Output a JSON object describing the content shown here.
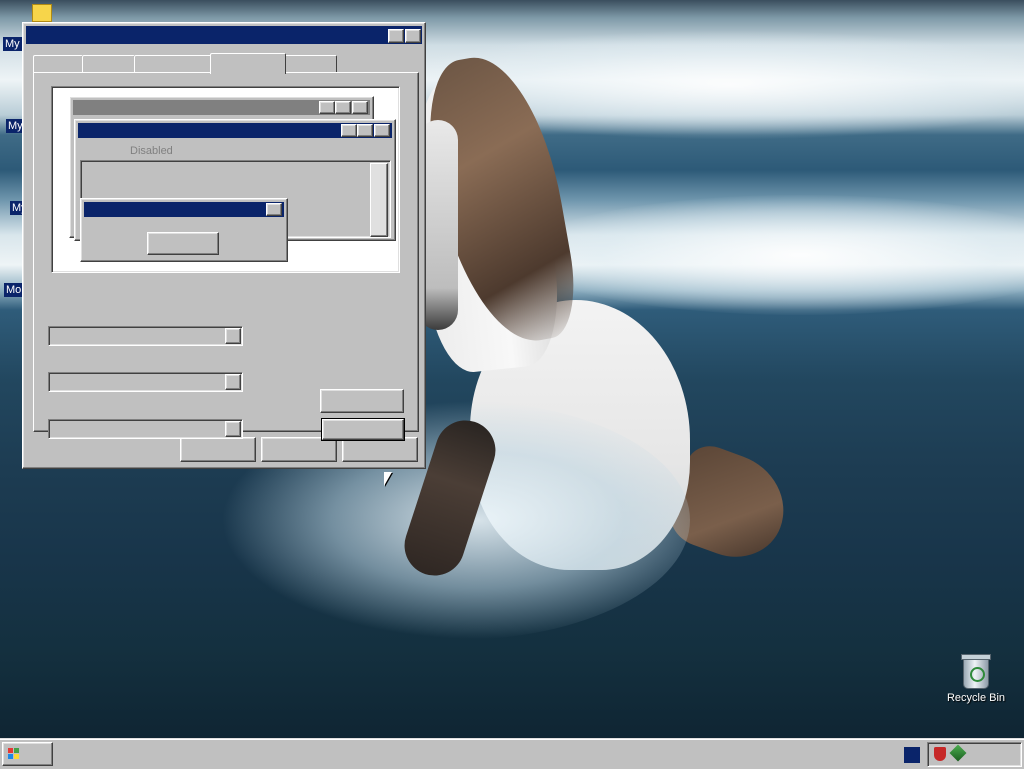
{
  "desktop": {
    "icons": [
      {
        "label": "My"
      },
      {
        "label": "My"
      },
      {
        "label": "My"
      },
      {
        "label": "Mo"
      }
    ],
    "recycle_bin": {
      "label": "Recycle Bin"
    }
  },
  "dialog": {
    "title": "",
    "tabs": [
      "",
      "",
      "",
      "",
      ""
    ],
    "active_tab_index": 3,
    "preview": {
      "inactive_window_title": "",
      "active_window_title": "",
      "menu_text": "Disabled",
      "message_box_title": "",
      "ok_button": ""
    },
    "buttons": {
      "ok": "",
      "cancel": "",
      "apply": ""
    }
  },
  "taskbar": {
    "start_label": "",
    "tray_icons": [
      "shield-icon",
      "network-icon"
    ]
  },
  "colors": {
    "active_title": "#0a246a",
    "inactive_title": "#808080",
    "face": "#c0c0c0"
  }
}
